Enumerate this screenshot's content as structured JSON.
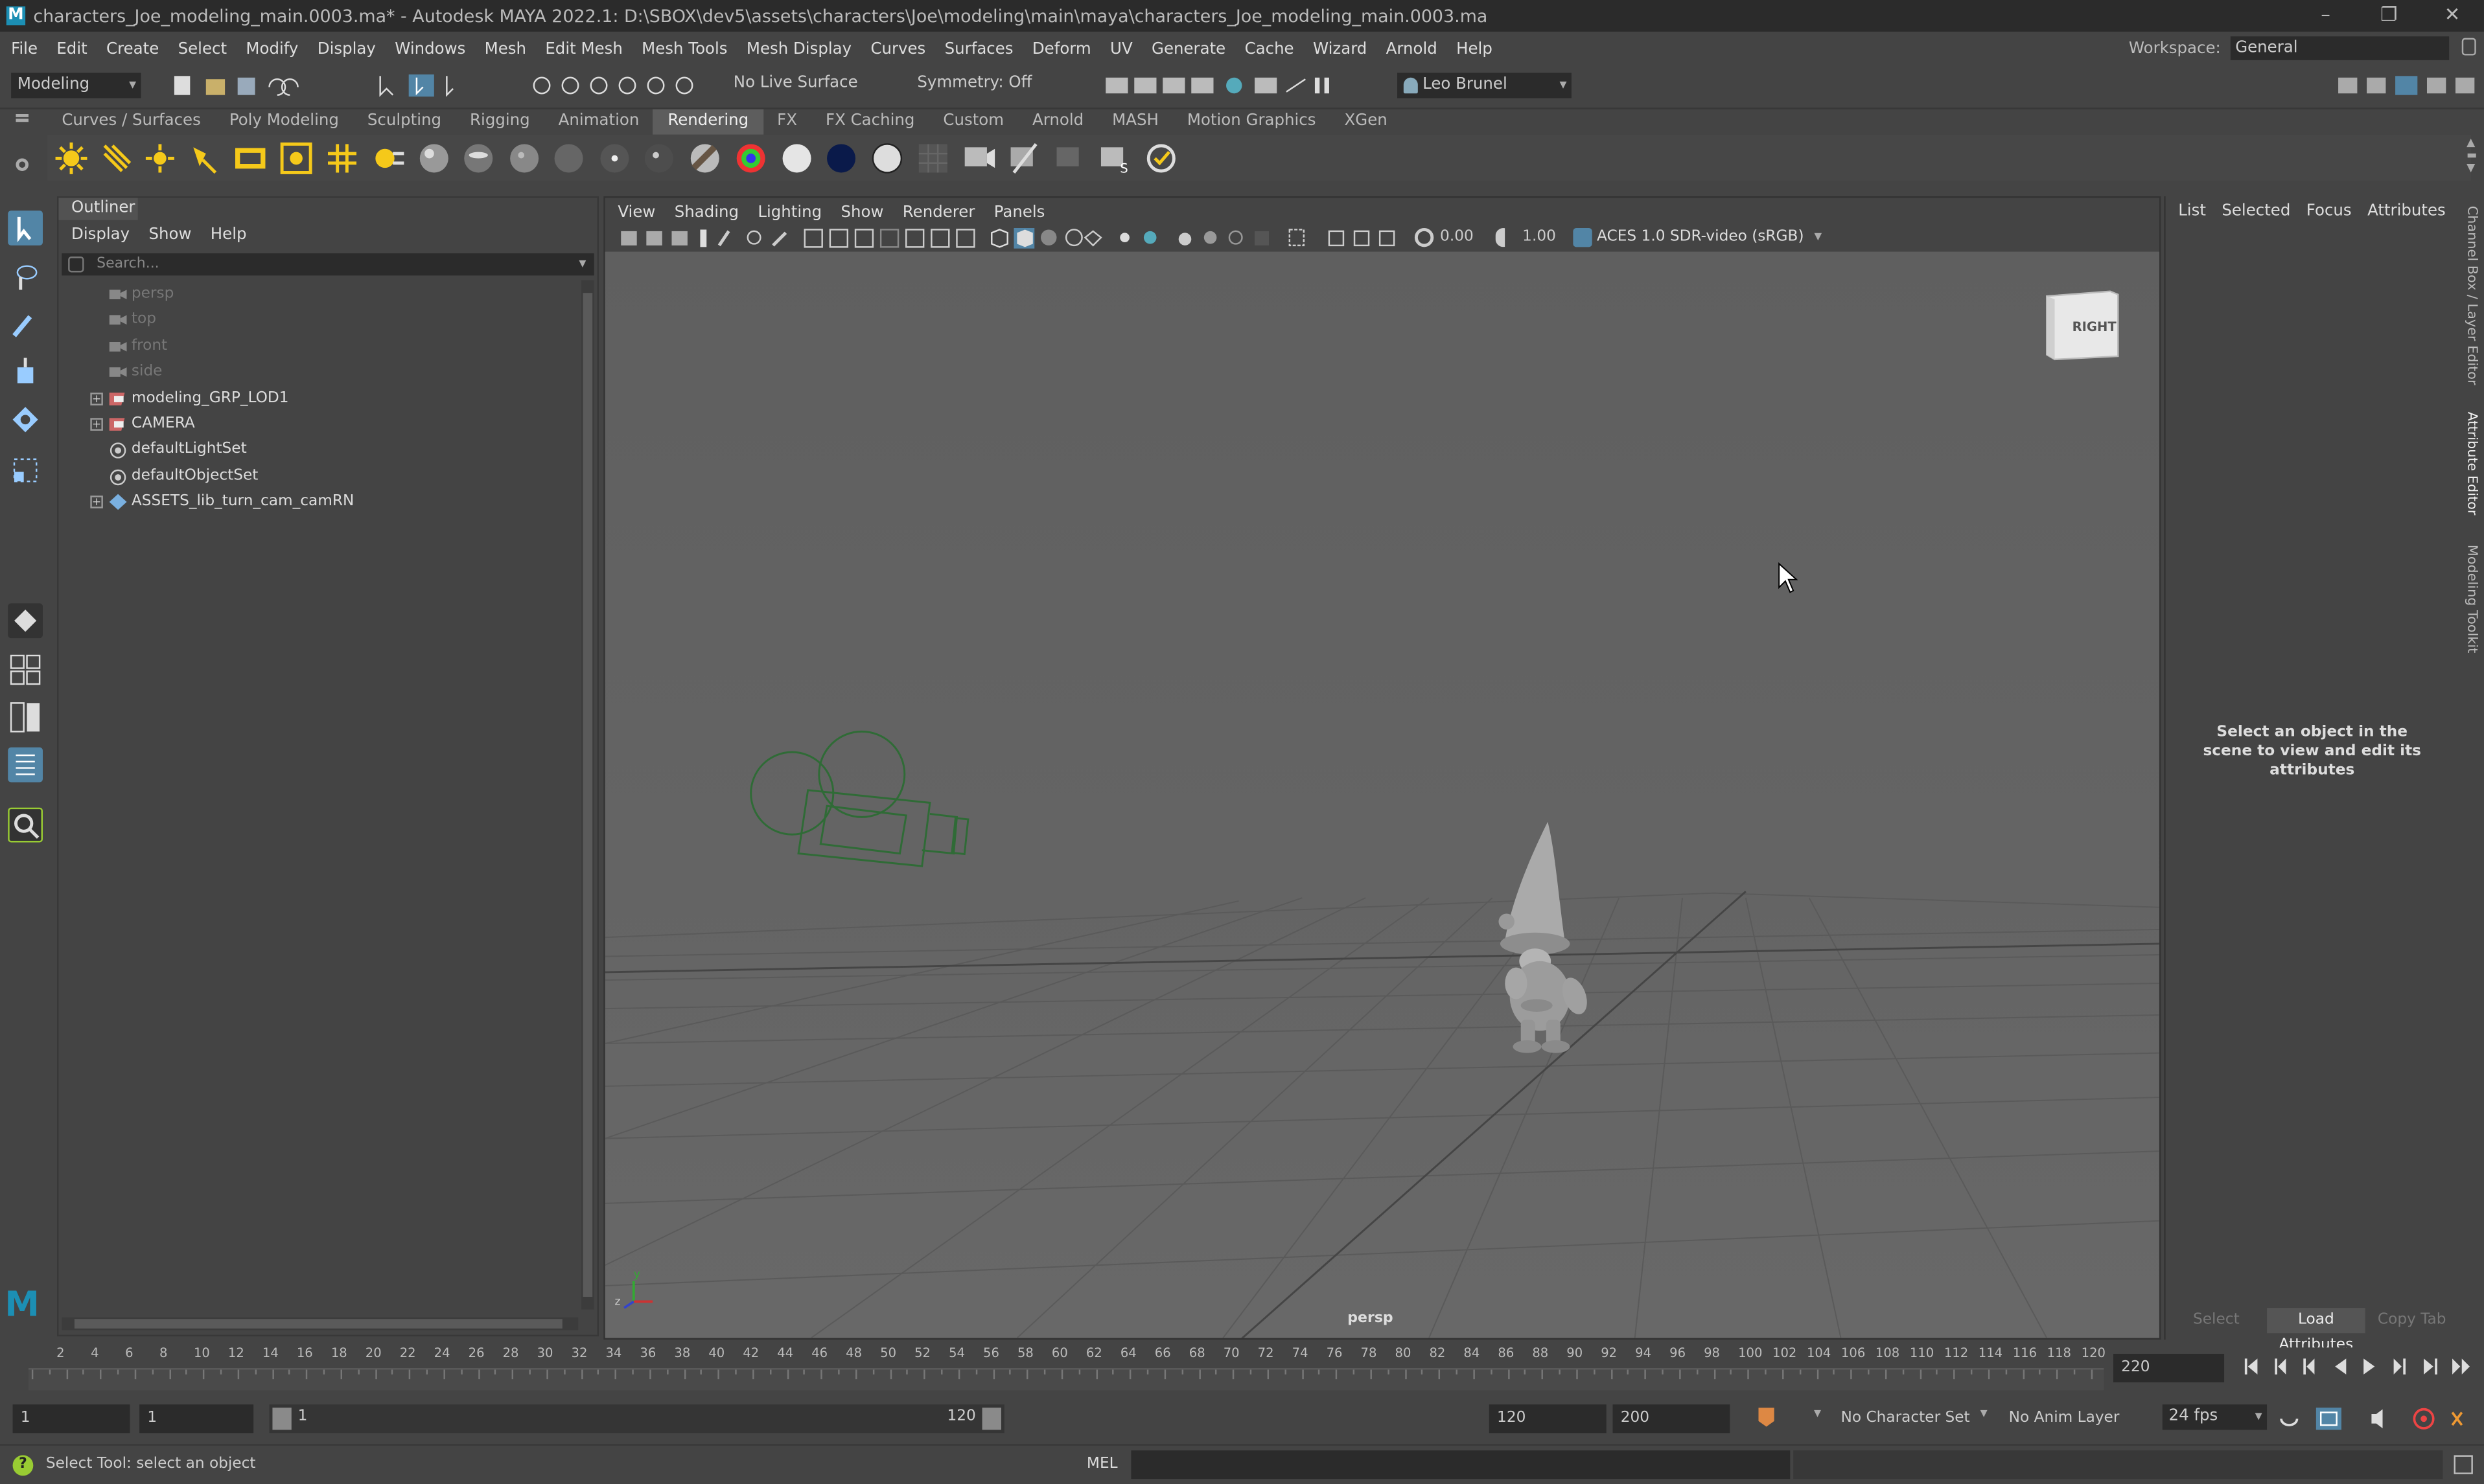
{
  "window": {
    "title": "characters_Joe_modeling_main.0003.ma* - Autodesk MAYA 2022.1: D:\\SBOX\\dev5\\assets\\characters\\Joe\\modeling\\main\\maya\\characters_Joe_modeling_main.0003.ma",
    "logo": "M"
  },
  "menubar": {
    "items": [
      "File",
      "Edit",
      "Create",
      "Select",
      "Modify",
      "Display",
      "Windows",
      "Mesh",
      "Edit Mesh",
      "Mesh Tools",
      "Mesh Display",
      "Curves",
      "Surfaces",
      "Deform",
      "UV",
      "Generate",
      "Cache",
      "Wizard",
      "Arnold",
      "Help"
    ],
    "workspace_label": "Workspace:",
    "workspace_value": "General"
  },
  "toolbar": {
    "menuset": "Modeling",
    "live_surface": "No Live Surface",
    "symmetry": "Symmetry: Off",
    "user": "Leo Brunel"
  },
  "shelf": {
    "tabs": [
      "Curves / Surfaces",
      "Poly Modeling",
      "Sculpting",
      "Rigging",
      "Animation",
      "Rendering",
      "FX",
      "FX Caching",
      "Custom",
      "Arnold",
      "MASH",
      "Motion Graphics",
      "XGen"
    ],
    "active_tab": "Rendering"
  },
  "outliner": {
    "title": "Outliner",
    "menu": [
      "Display",
      "Show",
      "Help"
    ],
    "search_placeholder": "Search...",
    "items": [
      {
        "label": "persp",
        "type": "camera",
        "expandable": false,
        "dim": true
      },
      {
        "label": "top",
        "type": "camera",
        "expandable": false,
        "dim": true
      },
      {
        "label": "front",
        "type": "camera",
        "expandable": false,
        "dim": true
      },
      {
        "label": "side",
        "type": "camera",
        "expandable": false,
        "dim": true
      },
      {
        "label": "modeling_GRP_LOD1",
        "type": "group",
        "expandable": true,
        "dim": false
      },
      {
        "label": "CAMERA",
        "type": "group",
        "expandable": true,
        "dim": false
      },
      {
        "label": "defaultLightSet",
        "type": "set",
        "expandable": false,
        "dim": false
      },
      {
        "label": "defaultObjectSet",
        "type": "set",
        "expandable": false,
        "dim": false
      },
      {
        "label": "ASSETS_lib_turn_cam_camRN",
        "type": "reference",
        "expandable": true,
        "dim": false
      }
    ]
  },
  "viewport": {
    "menu": [
      "View",
      "Shading",
      "Lighting",
      "Show",
      "Renderer",
      "Panels"
    ],
    "exposure": "0.00",
    "gamma": "1.00",
    "colorspace": "ACES 1.0 SDR-video (sRGB)",
    "viewcube_label": "RIGHT",
    "camera_name": "persp",
    "axis_y": "y",
    "axis_z": "z"
  },
  "attribute_editor": {
    "tabs": [
      "List",
      "Selected",
      "Focus",
      "Attributes"
    ],
    "message": "Select an object in the scene to view and edit its attributes",
    "buttons": [
      "Select",
      "Load Attributes",
      "Copy Tab"
    ]
  },
  "side_tabs": [
    "Channel Box / Layer Editor",
    "Attribute Editor",
    "Modeling Toolkit"
  ],
  "timeline": {
    "ticks": [
      "2",
      "4",
      "6",
      "8",
      "10",
      "12",
      "14",
      "16",
      "18",
      "20",
      "22",
      "24",
      "26",
      "28",
      "30",
      "32",
      "34",
      "36",
      "38",
      "40",
      "42",
      "44",
      "46",
      "48",
      "50",
      "52",
      "54",
      "56",
      "58",
      "60",
      "62",
      "64",
      "66",
      "68",
      "70",
      "72",
      "74",
      "76",
      "78",
      "80",
      "82",
      "84",
      "86",
      "88",
      "90",
      "92",
      "94",
      "96",
      "98",
      "100",
      "102",
      "104",
      "106",
      "108",
      "110",
      "112",
      "114",
      "116",
      "118",
      "120"
    ],
    "current_frame": "220"
  },
  "range": {
    "start": "1",
    "anim_start": "1",
    "slider_start": "1",
    "slider_end": "120",
    "end": "120",
    "anim_end": "200",
    "character_set": "No Character Set",
    "anim_layer": "No Anim Layer",
    "fps": "24 fps"
  },
  "status": {
    "help_line": "Select Tool: select an object",
    "cmd_lang": "MEL"
  },
  "colors": {
    "accent": "#5285a6",
    "viewport_bg": "#646464",
    "panel_bg": "#444444",
    "field_bg": "#2b2b2b"
  }
}
